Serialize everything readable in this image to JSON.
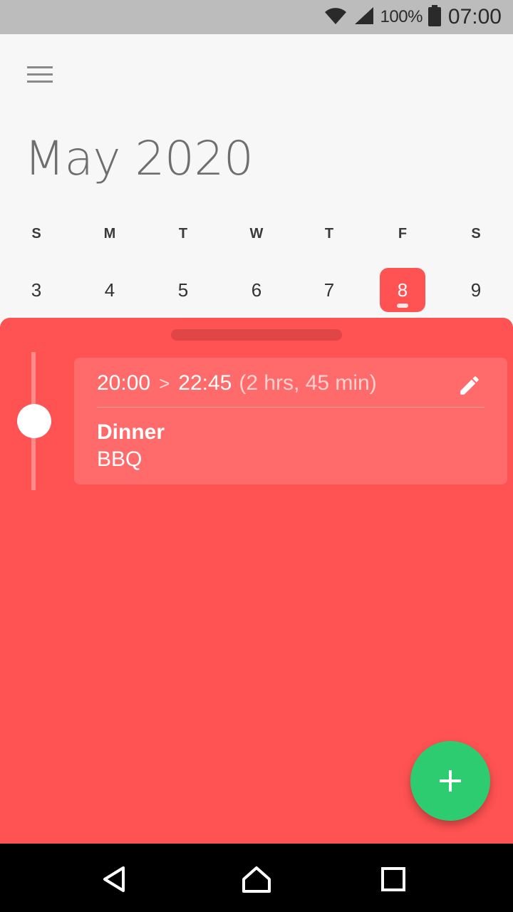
{
  "status_bar": {
    "battery_percent": "100%",
    "time": "07:00",
    "icons": [
      "wifi-icon",
      "signal-icon",
      "battery-icon"
    ]
  },
  "header": {
    "menu_icon": "hamburger-menu-icon",
    "month_title": "May 2020"
  },
  "week": {
    "days_of_week": [
      "S",
      "M",
      "T",
      "W",
      "T",
      "F",
      "S"
    ],
    "dates": [
      "3",
      "4",
      "5",
      "6",
      "7",
      "8",
      "9"
    ],
    "selected_index": 5
  },
  "event": {
    "start": "20:00",
    "separator": ">",
    "end": "22:45",
    "duration": "(2 hrs, 45 min)",
    "title": "Dinner",
    "subtitle": "BBQ",
    "edit_icon": "pencil-icon"
  },
  "fab": {
    "icon": "plus-icon"
  },
  "nav_bar": {
    "icons": [
      "back-icon",
      "home-icon",
      "recents-icon"
    ]
  },
  "colors": {
    "accent": "#ff5252",
    "card": "#ff6b6b",
    "fab": "#2ecc71",
    "status_bar": "#bcbcbc"
  }
}
